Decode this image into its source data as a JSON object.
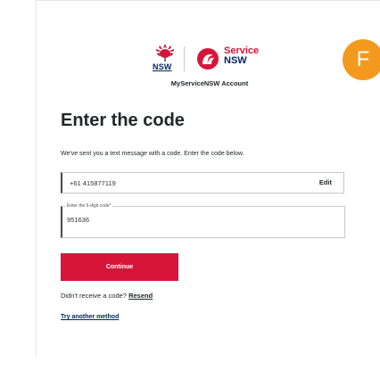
{
  "brand": {
    "nsw_logo_text": "NSW",
    "service_line1": "Service",
    "service_line2": "NSW",
    "account_label": "MyServiceNSW Account",
    "colors": {
      "red": "#d7153a",
      "navy": "#002664",
      "avatar": "#f39a1e"
    }
  },
  "user": {
    "avatar_initial": "F"
  },
  "page": {
    "title": "Enter the code",
    "description": "We've sent you a text message with a code. Enter the code below."
  },
  "phone": {
    "value": "+61 415877119",
    "edit_label": "Edit"
  },
  "code": {
    "legend": "Enter the 6-digit code*",
    "value": "951636"
  },
  "actions": {
    "continue_label": "Continue",
    "resend_prompt": "Didn't receive a code?",
    "resend_label": "Resend",
    "try_another_label": "Try another method"
  }
}
